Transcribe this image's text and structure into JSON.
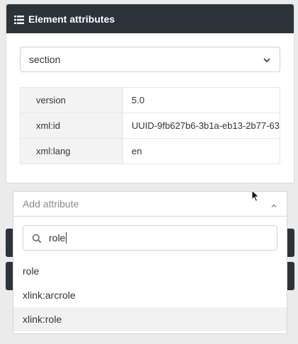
{
  "panel": {
    "title": "Element attributes",
    "title_icon": "list-icon",
    "element_select": {
      "value": "section",
      "icon": "chevron-down-icon"
    },
    "attributes": [
      {
        "name": "version",
        "value": "5.0"
      },
      {
        "name": "xml:id",
        "value": "UUID-9fb627b6-3b1a-eb13-2b77-63"
      },
      {
        "name": "xml:lang",
        "value": "en"
      }
    ]
  },
  "add_attribute": {
    "placeholder": "Add attribute",
    "icon": "chevron-up-icon",
    "search": {
      "value": "role",
      "icon": "search-icon"
    },
    "options": [
      "role",
      "xlink:arcrole",
      "xlink:role"
    ],
    "highlighted_index": 2
  }
}
